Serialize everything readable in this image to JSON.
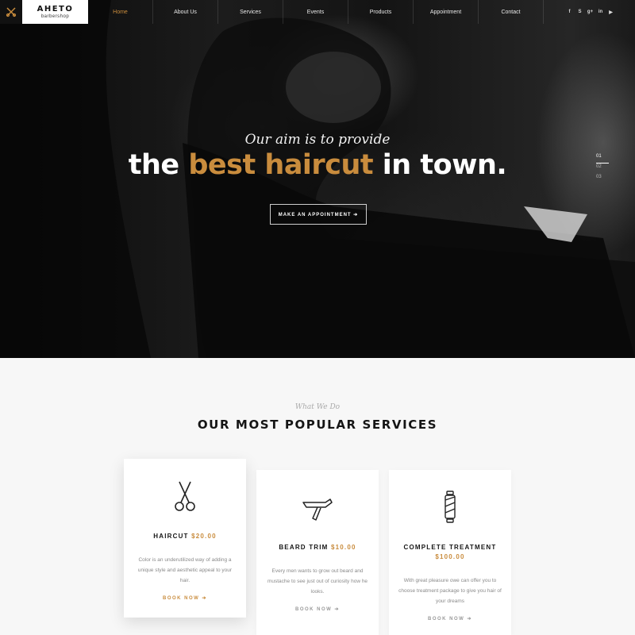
{
  "logo": {
    "name": "AHETO",
    "sub": "barbershop",
    "icon": "scissors-icon"
  },
  "nav": {
    "items": [
      {
        "label": "Home",
        "active": true
      },
      {
        "label": "About Us",
        "active": false
      },
      {
        "label": "Services",
        "active": false
      },
      {
        "label": "Events",
        "active": false
      },
      {
        "label": "Products",
        "active": false
      },
      {
        "label": "Appointment",
        "active": false
      },
      {
        "label": "Contact",
        "active": false
      }
    ],
    "socials": [
      "facebook-icon",
      "skype-icon",
      "google-plus-icon",
      "linkedin-icon",
      "youtube-icon"
    ]
  },
  "hero": {
    "tagline": "Our aim is to provide",
    "headline_start": "the ",
    "headline_accent": "best haircut",
    "headline_end": " in town.",
    "cta_label": "MAKE AN APPOINTMENT ➔",
    "slides": [
      "01",
      "02",
      "03"
    ],
    "active_slide": "01"
  },
  "services": {
    "kicker": "What We Do",
    "title": "OUR MOST POPULAR SERVICES",
    "cards": [
      {
        "title": "HAIRCUT",
        "price": "$20.00",
        "icon": "scissors-icon",
        "description": "Color is an underutilized way of adding a unique style and aesthetic appeal to your hair.",
        "link": "BOOK NOW ➔"
      },
      {
        "title": "BEARD TRIM",
        "price": "$10.00",
        "icon": "straight-razor-icon",
        "description": "Every men wants to grow out beard and mustache to see just out of curiosity how he looks.",
        "link": "BOOK NOW ➔"
      },
      {
        "title": "COMPLETE TREATMENT",
        "price": "$100.00",
        "icon": "barber-pole-icon",
        "description": "With great pleasure owe can offer you to choose treatment package to give you hair of your dreams",
        "link": "BOOK NOW ➔"
      }
    ]
  },
  "colors": {
    "accent": "#c98c3d",
    "dark": "#111111",
    "light_bg": "#f7f7f7"
  }
}
